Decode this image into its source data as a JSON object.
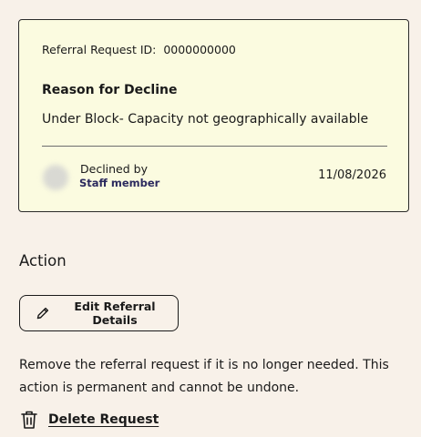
{
  "referral": {
    "id_label": "Referral Request ID:",
    "id_value": "0000000000",
    "reason_title": "Reason for Decline",
    "reason_text": "Under Block- Capacity not geographically available",
    "declined_by_label": "Declined by",
    "declined_by_name": "Staff member",
    "declined_date": "11/08/2026"
  },
  "action": {
    "heading": "Action",
    "edit_button_label": "Edit Referral Details",
    "edit_icon": "pencil-icon",
    "remove_description": "Remove the referral request if it is no longer needed. This action is permanent and cannot be undone.",
    "delete_label": "Delete Request",
    "delete_icon": "trash-icon"
  },
  "colors": {
    "page_background": "#f8f1e9",
    "card_background": "#fbfbe0",
    "staff_name": "#2c2a5e"
  }
}
